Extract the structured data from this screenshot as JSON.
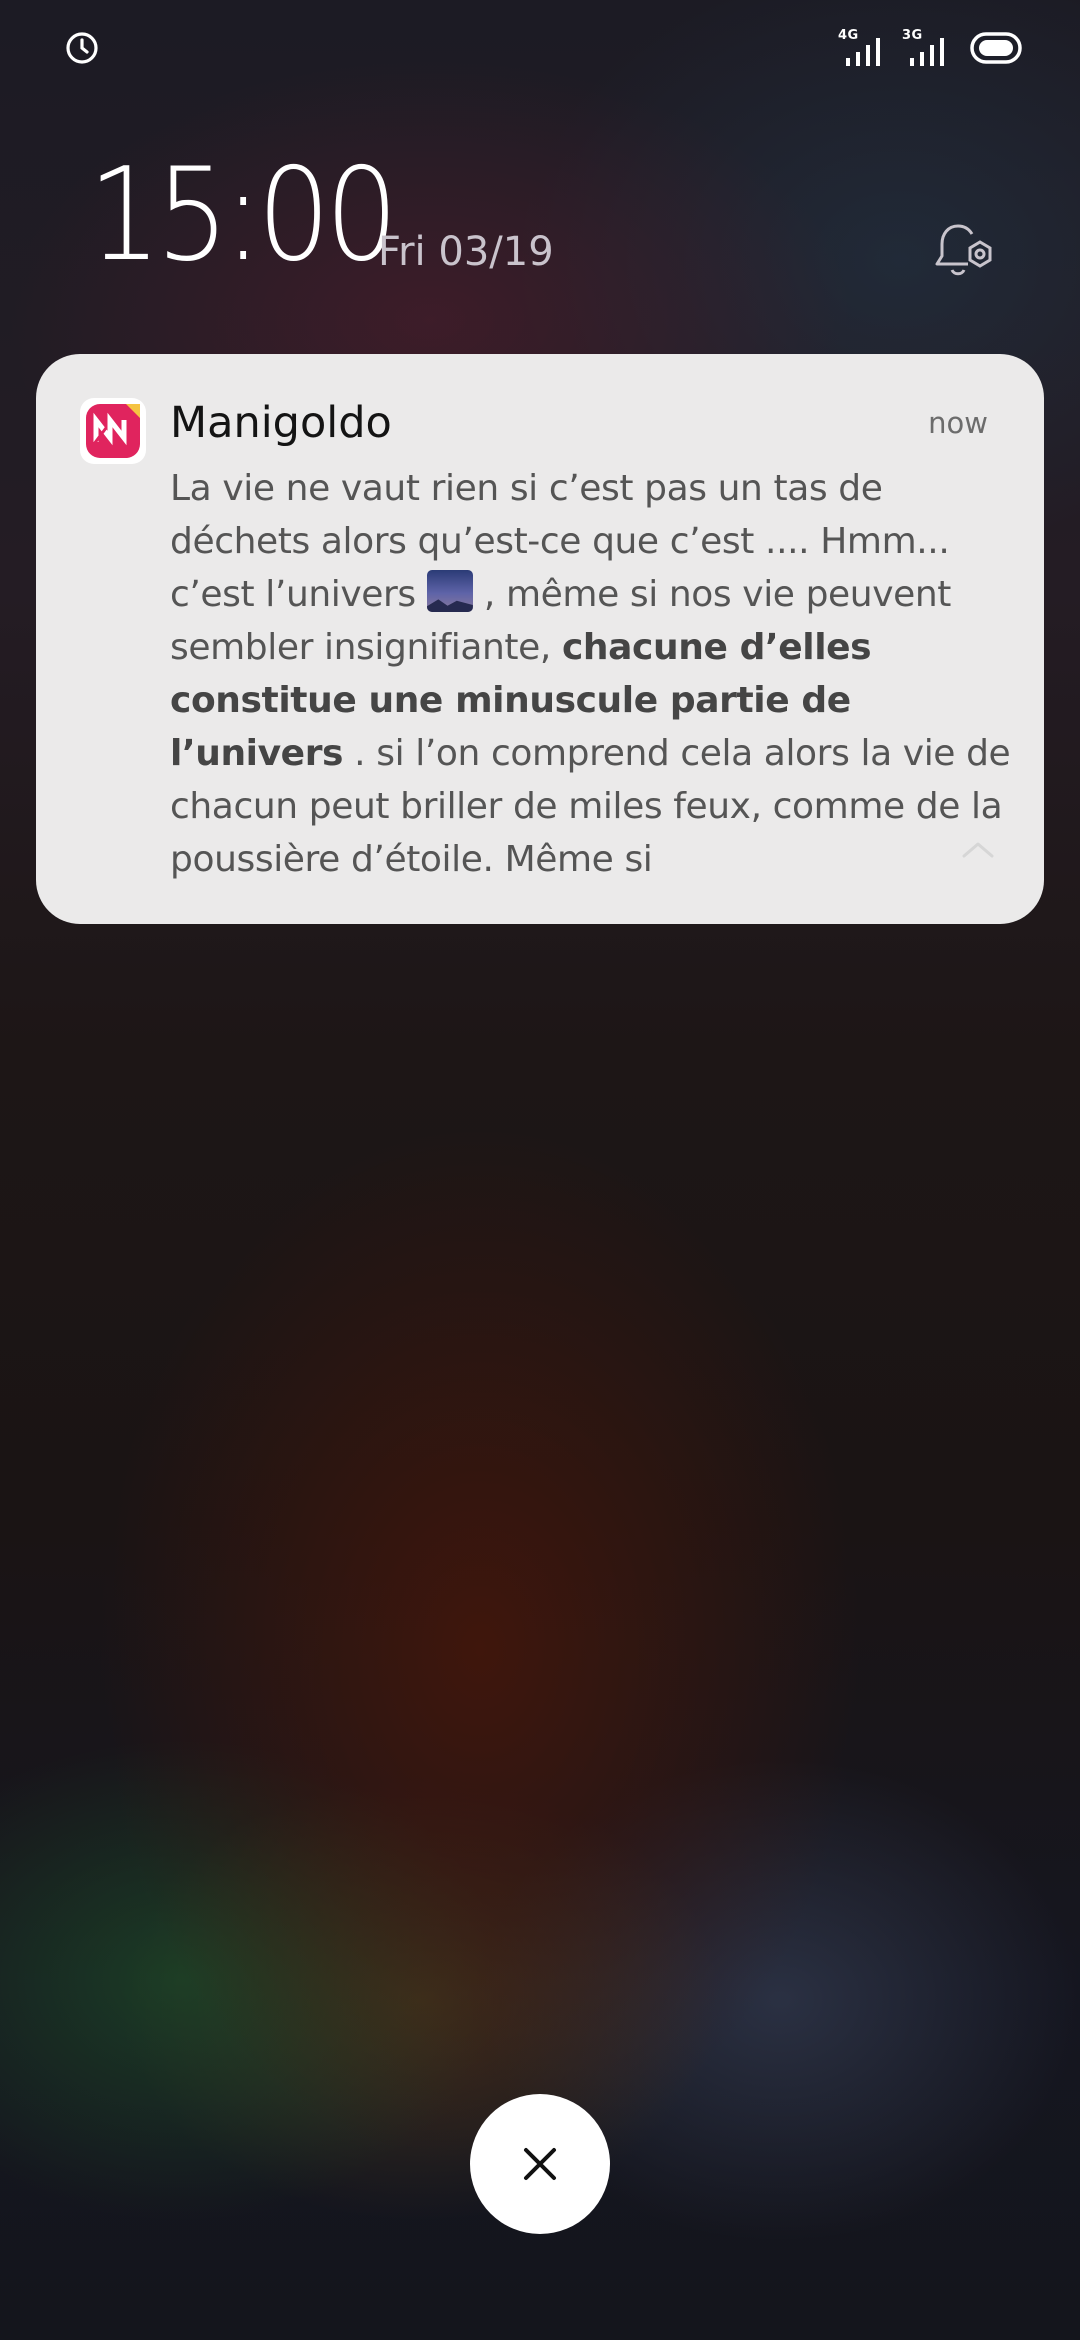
{
  "status_bar": {
    "alarm_icon": "alarm-clock-icon",
    "signal_1_label": "4G",
    "signal_2_label": "3G",
    "battery_icon": "battery-icon"
  },
  "lockscreen": {
    "time": "15:00",
    "date": "Fri 03/19",
    "notification_settings_icon": "bell-settings-icon"
  },
  "notification": {
    "app_name": "Manigoldo",
    "timestamp": "now",
    "app_icon": "manigoldo-app-icon",
    "message_part1": "La vie ne vaut rien si c’est pas un tas de déchets alors qu’est-ce que c’est .... Hmm... c’est l’univers",
    "message_emoji": "night-with-stars-emoji",
    "message_part2": ", même si nos vie peuvent sembler insignifiante,",
    "message_bold": "chacune d’elles constitue une minuscule partie de l’univers",
    "message_part3": ". si l’on comprend cela alors la vie de chacun peut briller de miles feux, comme de la poussière d’étoile. Même si",
    "expand_icon": "chevron-up-icon"
  },
  "dismiss": {
    "icon": "close-icon"
  },
  "colors": {
    "card_background": "#ebeaea",
    "app_icon_accent": "#e0245e",
    "text_primary": "#141414",
    "text_body": "#555555"
  }
}
